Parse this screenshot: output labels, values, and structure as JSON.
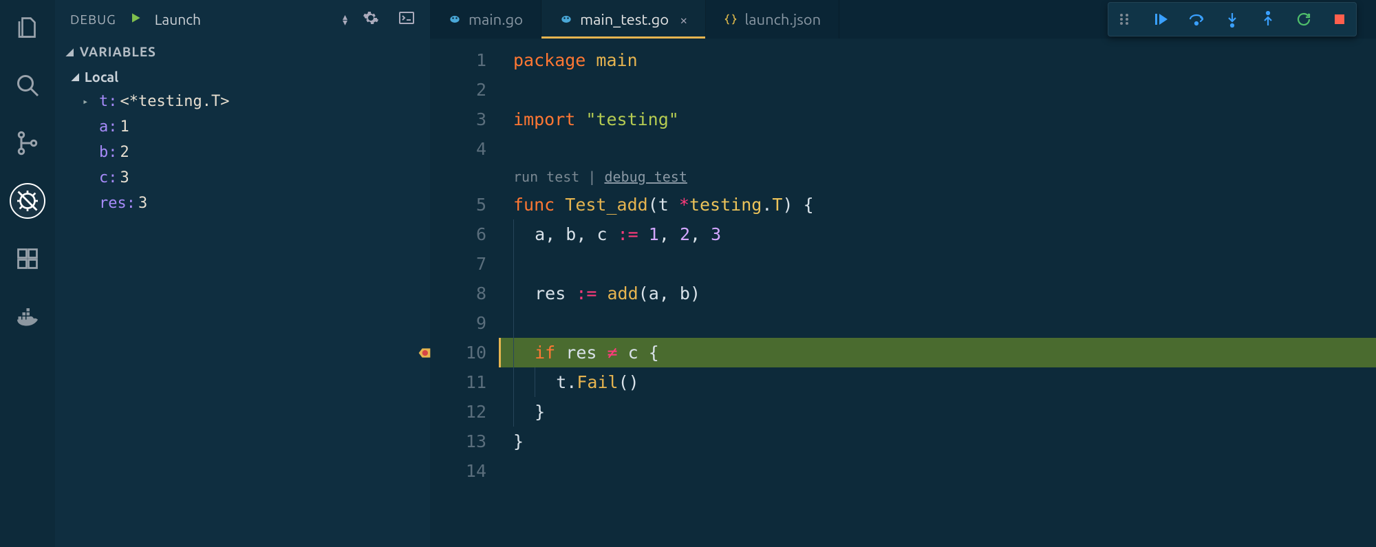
{
  "activity": {
    "items": [
      "explorer",
      "search",
      "scm",
      "debug",
      "extensions",
      "docker"
    ],
    "active": "debug"
  },
  "debugBar": {
    "label": "DEBUG",
    "config": "Launch"
  },
  "variablesSection": {
    "title": "VARIABLES",
    "scope": "Local",
    "vars": [
      {
        "name": "t:",
        "value": "<*testing.T>",
        "expandable": true
      },
      {
        "name": "a:",
        "value": "1",
        "expandable": false
      },
      {
        "name": "b:",
        "value": "2",
        "expandable": false
      },
      {
        "name": "c:",
        "value": "3",
        "expandable": false
      },
      {
        "name": "res:",
        "value": "3",
        "expandable": false
      }
    ]
  },
  "tabs": [
    {
      "label": "main.go",
      "iconType": "go",
      "active": false,
      "dirty": false
    },
    {
      "label": "main_test.go",
      "iconType": "go",
      "active": true,
      "dirty": true
    },
    {
      "label": "launch.json",
      "iconType": "json",
      "active": false,
      "dirty": false
    }
  ],
  "debugControls": {
    "continueColor": "#3aa0ff",
    "stepOverColor": "#3aa0ff",
    "stepIntoColor": "#3aa0ff",
    "stepOutColor": "#3aa0ff",
    "restartColor": "#4fbf6b",
    "stopColor": "#ff5f4d"
  },
  "editor": {
    "codelens": {
      "run": "run test",
      "sep": "|",
      "debug": "debug test"
    },
    "breakpointLine": 10,
    "highlightLine": 10,
    "lines": [
      {
        "n": 1,
        "tokens": [
          [
            "kw",
            "package"
          ],
          [
            "sp",
            " "
          ],
          [
            "pkg",
            "main"
          ]
        ]
      },
      {
        "n": 2,
        "tokens": []
      },
      {
        "n": 3,
        "tokens": [
          [
            "kw",
            "import"
          ],
          [
            "sp",
            " "
          ],
          [
            "str",
            "\"testing\""
          ]
        ]
      },
      {
        "n": 4,
        "tokens": []
      },
      {
        "codelens": true
      },
      {
        "n": 5,
        "tokens": [
          [
            "kw",
            "func"
          ],
          [
            "sp",
            " "
          ],
          [
            "fn",
            "Test_add"
          ],
          [
            "punc",
            "("
          ],
          [
            "id",
            "t"
          ],
          [
            "sp",
            " "
          ],
          [
            "op",
            "*"
          ],
          [
            "type",
            "testing"
          ],
          [
            "punc",
            "."
          ],
          [
            "type",
            "T"
          ],
          [
            "punc",
            ")"
          ],
          [
            "sp",
            " "
          ],
          [
            "punc",
            "{"
          ]
        ]
      },
      {
        "n": 6,
        "indent": 1,
        "tokens": [
          [
            "id",
            "a"
          ],
          [
            "punc",
            ","
          ],
          [
            "sp",
            " "
          ],
          [
            "id",
            "b"
          ],
          [
            "punc",
            ","
          ],
          [
            "sp",
            " "
          ],
          [
            "id",
            "c"
          ],
          [
            "sp",
            " "
          ],
          [
            "op",
            ":="
          ],
          [
            "sp",
            " "
          ],
          [
            "num",
            "1"
          ],
          [
            "punc",
            ","
          ],
          [
            "sp",
            " "
          ],
          [
            "num",
            "2"
          ],
          [
            "punc",
            ","
          ],
          [
            "sp",
            " "
          ],
          [
            "num",
            "3"
          ]
        ]
      },
      {
        "n": 7,
        "indent": 1,
        "tokens": []
      },
      {
        "n": 8,
        "indent": 1,
        "tokens": [
          [
            "id",
            "res"
          ],
          [
            "sp",
            " "
          ],
          [
            "op",
            ":="
          ],
          [
            "sp",
            " "
          ],
          [
            "call",
            "add"
          ],
          [
            "punc",
            "("
          ],
          [
            "id",
            "a"
          ],
          [
            "punc",
            ","
          ],
          [
            "sp",
            " "
          ],
          [
            "id",
            "b"
          ],
          [
            "punc",
            ")"
          ]
        ]
      },
      {
        "n": 9,
        "indent": 1,
        "tokens": []
      },
      {
        "n": 10,
        "indent": 1,
        "tokens": [
          [
            "kw",
            "if"
          ],
          [
            "sp",
            " "
          ],
          [
            "id",
            "res"
          ],
          [
            "sp",
            " "
          ],
          [
            "op",
            "≠"
          ],
          [
            "sp",
            " "
          ],
          [
            "id",
            "c"
          ],
          [
            "sp",
            " "
          ],
          [
            "punc",
            "{"
          ]
        ]
      },
      {
        "n": 11,
        "indent": 2,
        "tokens": [
          [
            "id",
            "t"
          ],
          [
            "punc",
            "."
          ],
          [
            "call",
            "Fail"
          ],
          [
            "punc",
            "()"
          ]
        ]
      },
      {
        "n": 12,
        "indent": 1,
        "tokens": [
          [
            "punc",
            "}"
          ]
        ]
      },
      {
        "n": 13,
        "tokens": [
          [
            "punc",
            "}"
          ]
        ]
      },
      {
        "n": 14,
        "tokens": []
      }
    ]
  }
}
